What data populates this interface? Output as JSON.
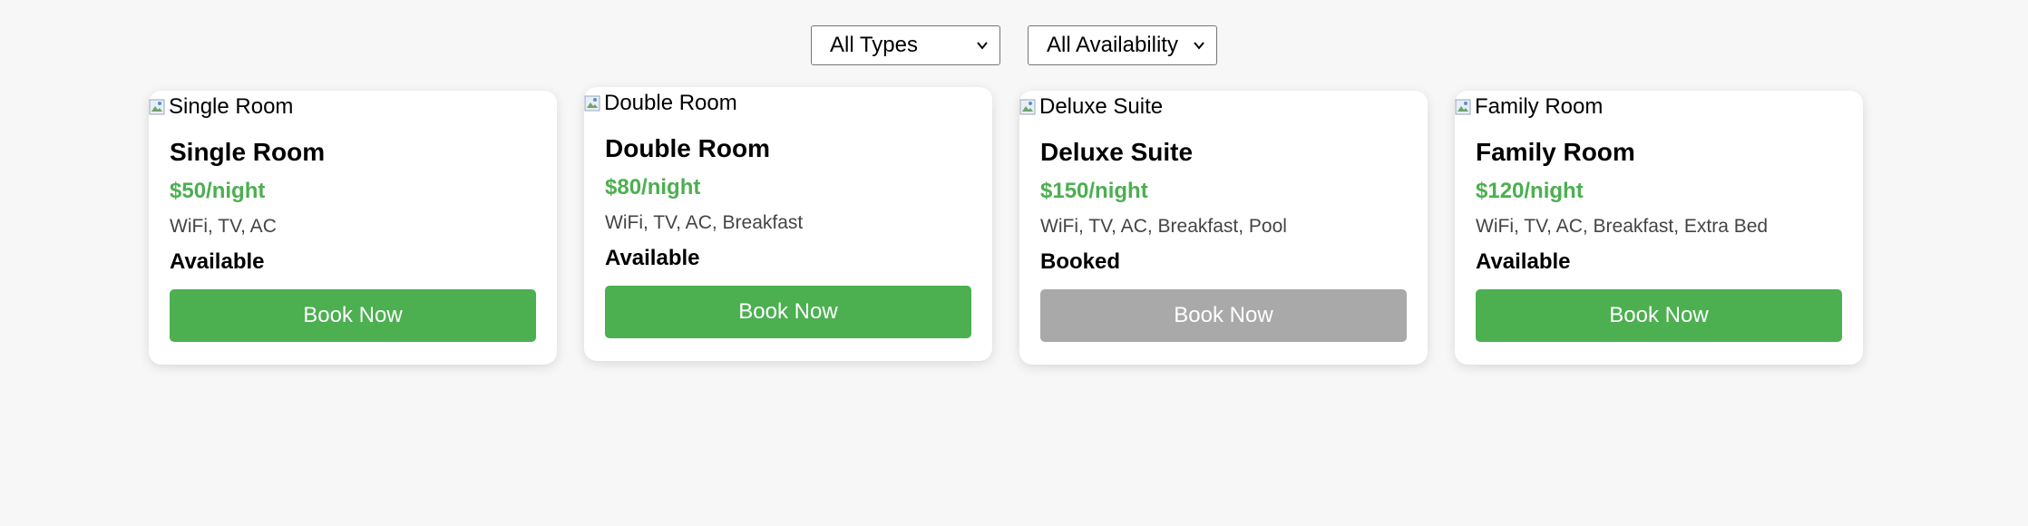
{
  "filters": {
    "type_selected": "All Types",
    "availability_selected": "All Availability"
  },
  "rooms": [
    {
      "image_alt": "Single Room",
      "name": "Single Room",
      "price": "$50/night",
      "amenities": "WiFi, TV, AC",
      "status": "Available",
      "button_label": "Book Now",
      "button_enabled": true
    },
    {
      "image_alt": "Double Room",
      "name": "Double Room",
      "price": "$80/night",
      "amenities": "WiFi, TV, AC, Breakfast",
      "status": "Available",
      "button_label": "Book Now",
      "button_enabled": true
    },
    {
      "image_alt": "Deluxe Suite",
      "name": "Deluxe Suite",
      "price": "$150/night",
      "amenities": "WiFi, TV, AC, Breakfast, Pool",
      "status": "Booked",
      "button_label": "Book Now",
      "button_enabled": false
    },
    {
      "image_alt": "Family Room",
      "name": "Family Room",
      "price": "$120/night",
      "amenities": "WiFi, TV, AC, Breakfast, Extra Bed",
      "status": "Available",
      "button_label": "Book Now",
      "button_enabled": true
    }
  ],
  "colors": {
    "accent": "#4caf50",
    "disabled": "#a9a9a9",
    "background": "#f7f7f7"
  },
  "icons": {
    "dropdown": "chevron-down-icon",
    "broken_image": "broken-image-icon"
  }
}
